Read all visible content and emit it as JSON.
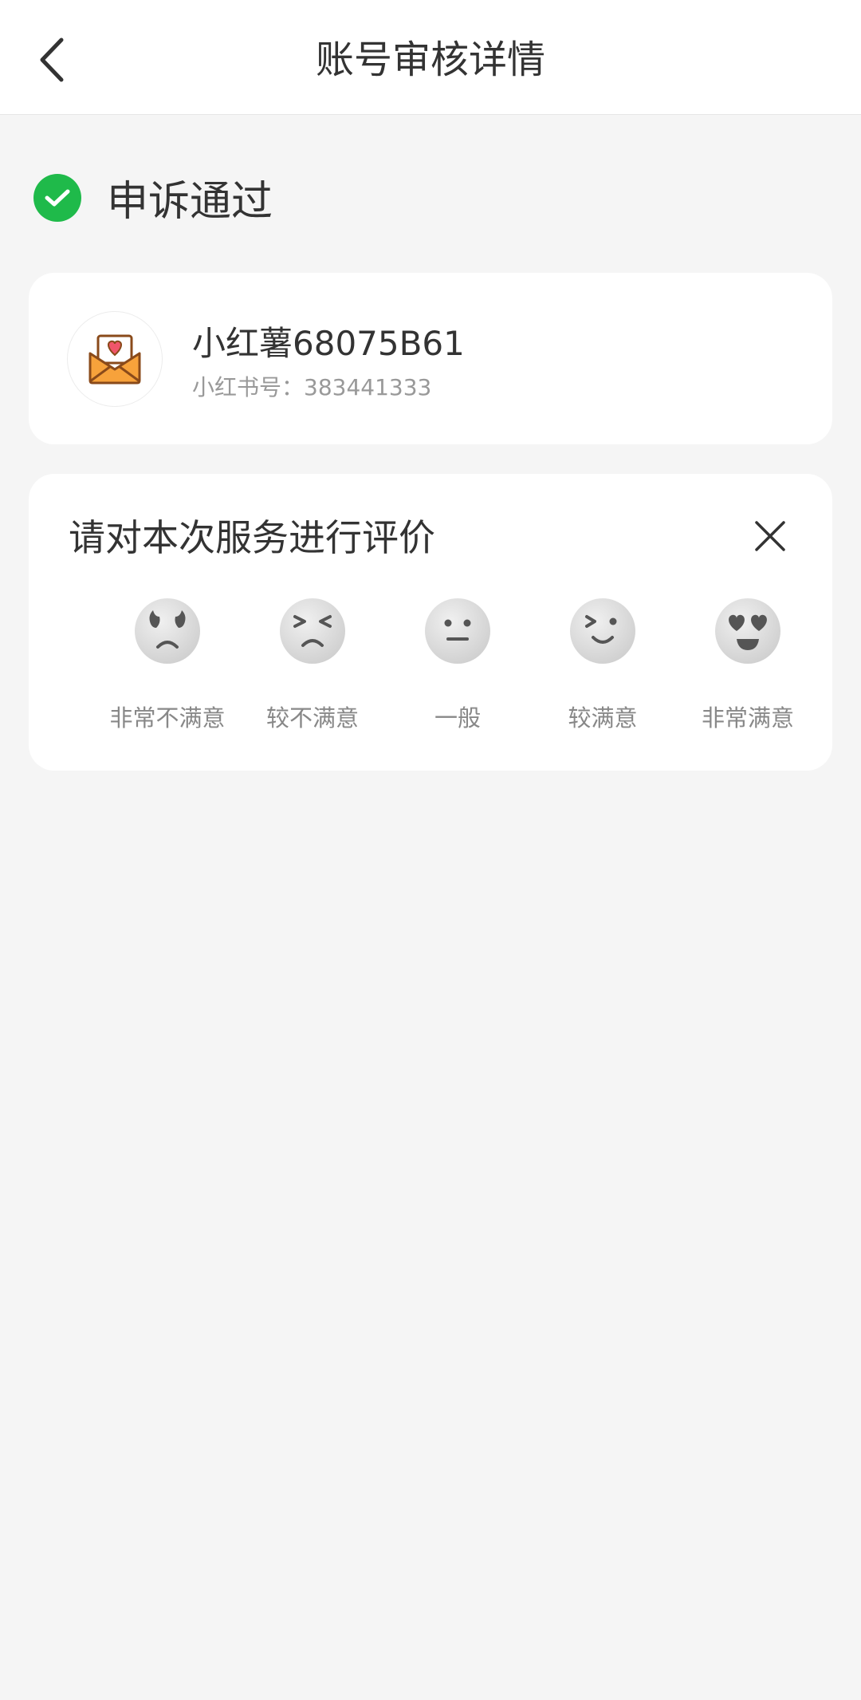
{
  "header": {
    "title": "账号审核详情",
    "back_icon": "chevron-left-icon"
  },
  "status": {
    "text": "申诉通过",
    "icon": "check-circle-icon",
    "color": "#1fba4a"
  },
  "account": {
    "name": "小红薯68075B61",
    "id_text": "小红书号：383441333",
    "avatar_icon": "envelope-heart-icon"
  },
  "rating": {
    "title": "请对本次服务进行评价",
    "close_icon": "close-icon",
    "options": [
      {
        "label": "非常不满意",
        "icon": "very-unsatisfied-face-icon"
      },
      {
        "label": "较不满意",
        "icon": "unsatisfied-face-icon"
      },
      {
        "label": "一般",
        "icon": "neutral-face-icon"
      },
      {
        "label": "较满意",
        "icon": "satisfied-face-icon"
      },
      {
        "label": "非常满意",
        "icon": "very-satisfied-face-icon"
      }
    ]
  }
}
